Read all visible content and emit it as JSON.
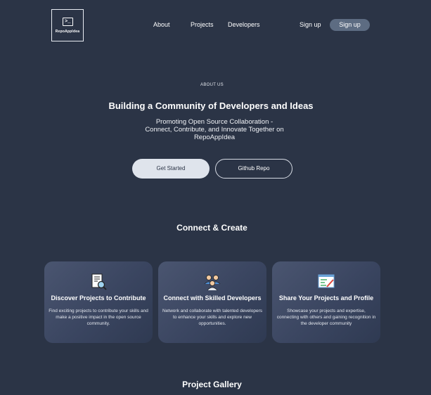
{
  "header": {
    "logo_text": "RepoAppIdea",
    "logo_glyph": ">_",
    "nav": [
      {
        "label": "About"
      },
      {
        "label": "Projects"
      },
      {
        "label": "Developers"
      }
    ],
    "sign_up_link": "Sign up",
    "sign_up_button": "Sign up"
  },
  "hero": {
    "eyebrow": "ABOUT US",
    "title": "Building a Community of Developers and Ideas",
    "subtitle": "Promoting Open Source Collaboration - Connect, Contribute, and Innovate Together on RepoAppIdea",
    "primary_button": "Get Started",
    "secondary_button": "Github Repo"
  },
  "connect": {
    "title": "Connect & Create",
    "cards": [
      {
        "icon": "document-search-icon",
        "title": "Discover Projects to Contribute",
        "description": "Find exciting projects to contribute your skills and make a positive impact in the open source community."
      },
      {
        "icon": "developers-group-icon",
        "title": "Connect with Skilled Developers",
        "description": "Network and collaborate with talented developers to enhance your skills and explore new opportunities."
      },
      {
        "icon": "chart-edit-icon",
        "title": "Share Your Projects and Profile",
        "description": "Showcase your projects and expertise, connecting with others and gaining recognition in the developer community"
      }
    ]
  },
  "gallery": {
    "title": "Project Gallery"
  },
  "colors": {
    "background": "#2b3446",
    "primary_button": "#dfe4ec",
    "signup_button": "#5d6c82"
  }
}
